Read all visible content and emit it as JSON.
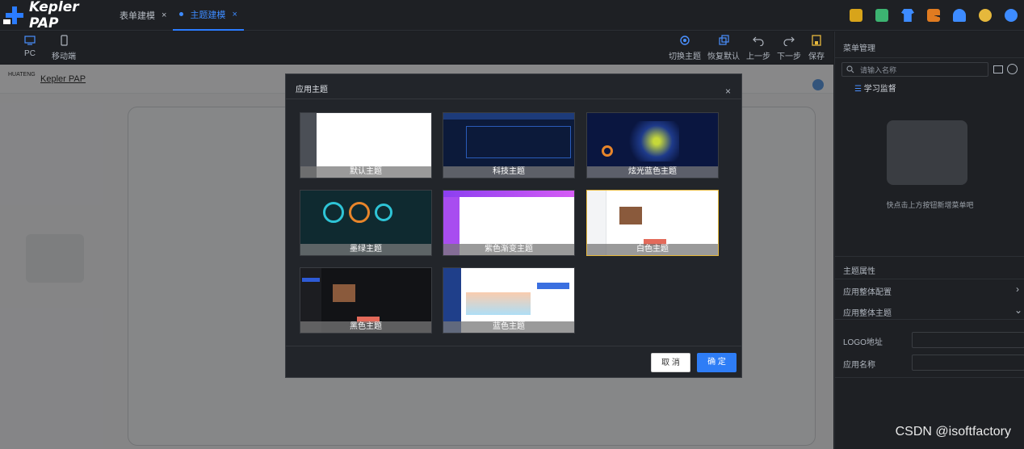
{
  "topbar": {
    "brand": "Kepler PAP",
    "tabs": [
      {
        "label": "表单建模",
        "close": "×"
      },
      {
        "label": "主题建模",
        "close": "×"
      }
    ]
  },
  "toolbar": {
    "left": [
      {
        "label": "PC",
        "icon": "desktop-icon"
      },
      {
        "label": "移动端",
        "icon": "mobile-icon"
      }
    ],
    "right": [
      {
        "label": "切换主题",
        "icon": "gear-icon"
      },
      {
        "label": "恢复默认",
        "icon": "copy-icon"
      },
      {
        "label": "上一步",
        "icon": "undo-icon"
      },
      {
        "label": "下一步",
        "icon": "redo-icon"
      },
      {
        "label": "保存",
        "icon": "save-icon"
      }
    ]
  },
  "canvas": {
    "app_title": "Kepler PAP",
    "logo_text": "HUATENG"
  },
  "right_panel": {
    "menu_title": "菜单管理",
    "search_placeholder": "请输入名称",
    "tree_item": "学习监督",
    "empty_text": "快点击上方按钮新增菜单吧",
    "theme_props_title": "主题属性",
    "overall_config": "应用整体配置",
    "overall_theme": "应用整体主题",
    "logo_url_label": "LOGO地址",
    "app_name_label": "应用名称"
  },
  "modal": {
    "title": "应用主题",
    "close": "×",
    "themes": [
      {
        "label": "默认主题",
        "selected": false
      },
      {
        "label": "科技主题",
        "selected": false
      },
      {
        "label": "炫光蓝色主题",
        "selected": false
      },
      {
        "label": "墨绿主题",
        "selected": false
      },
      {
        "label": "紫色渐变主题",
        "selected": false
      },
      {
        "label": "白色主题",
        "selected": true
      },
      {
        "label": "黑色主题",
        "selected": false
      },
      {
        "label": "蓝色主题",
        "selected": false
      }
    ],
    "cancel": "取 消",
    "ok": "确 定"
  },
  "watermark": "CSDN @isoftfactory",
  "colors": {
    "accent": "#2e7df6",
    "selected_border": "#e6b83c",
    "tab_active": "#3d8bff"
  }
}
